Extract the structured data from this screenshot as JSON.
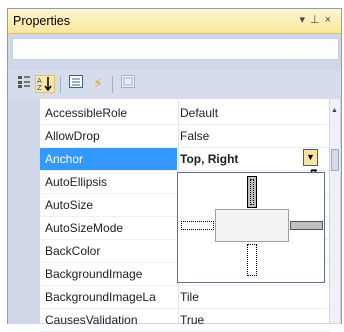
{
  "title": "Properties",
  "title_icons": [
    "pin-dropdown",
    "pin",
    "close"
  ],
  "toolbar": [
    "categorized",
    "alphabetical",
    "properties",
    "events",
    "property-pages"
  ],
  "properties": [
    {
      "name": "AccessibleRole",
      "value": "Default"
    },
    {
      "name": "AllowDrop",
      "value": "False"
    },
    {
      "name": "Anchor",
      "value": "Top, Right",
      "selected": true
    },
    {
      "name": "AutoEllipsis",
      "value": ""
    },
    {
      "name": "AutoSize",
      "value": ""
    },
    {
      "name": "AutoSizeMode",
      "value": ""
    },
    {
      "name": "BackColor",
      "value": ""
    },
    {
      "name": "BackgroundImage",
      "value": ""
    },
    {
      "name": "BackgroundImageLa",
      "value": "Tile"
    },
    {
      "name": "CausesValidation",
      "value": "True"
    }
  ],
  "anchor_editor": {
    "top": true,
    "right": true,
    "bottom": false,
    "left": false
  },
  "colors": {
    "selection": "#3399ff",
    "title_bar": "#fbe79a",
    "panel": "#cfd7e8"
  }
}
